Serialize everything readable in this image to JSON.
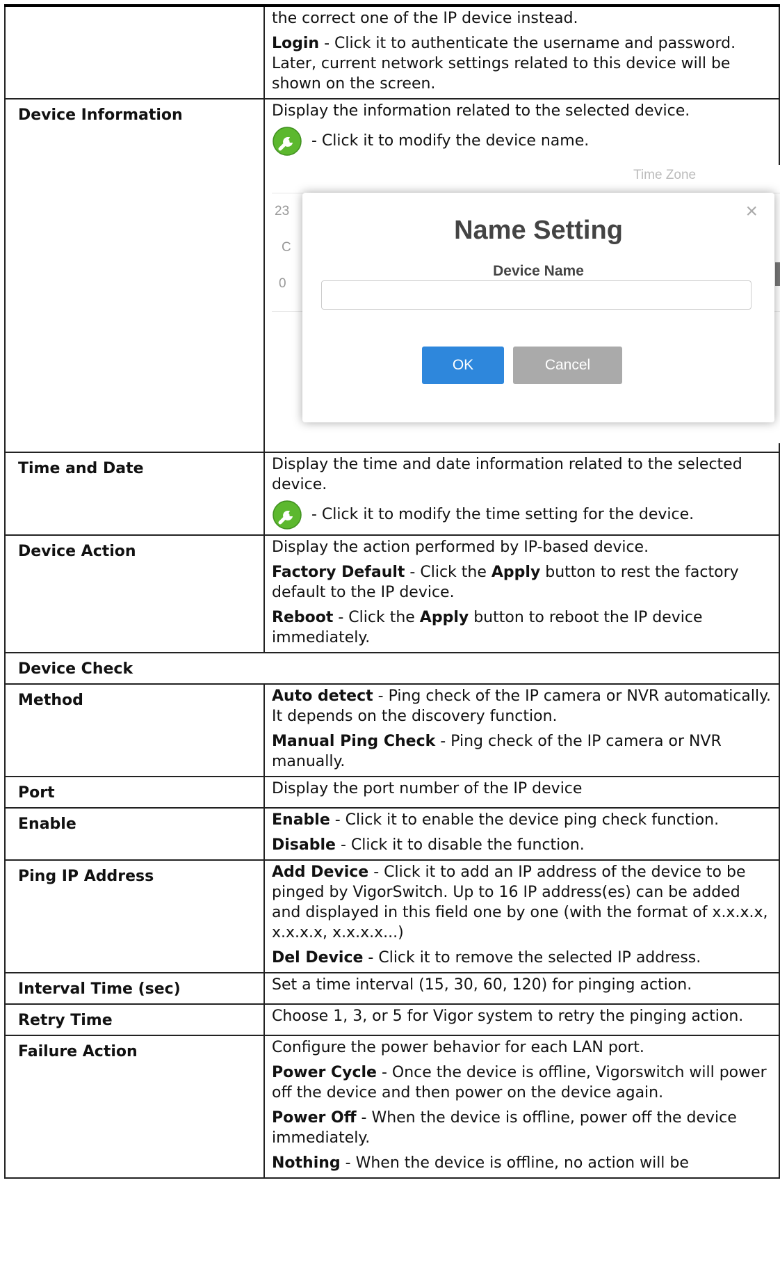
{
  "rows": {
    "login": {
      "cont_text": "the correct one of the IP device instead.",
      "login_term": "Login",
      "login_text": " - Click it to authenticate the username and password. Later, current network settings related to this device will be shown on the screen."
    },
    "device_info": {
      "label": "Device Information",
      "line1": "Display the information related to the selected device.",
      "icon_text": " - Click it to modify the device name.",
      "dialog": {
        "bg_header": "Time Zone",
        "bg_fragments": [
          "23",
          "C",
          "0"
        ],
        "title": "Name Setting",
        "field_label": "Device Name",
        "field_value": "",
        "ok_label": "OK",
        "cancel_label": "Cancel",
        "close_glyph": "×"
      }
    },
    "time_date": {
      "label": "Time and Date",
      "line1": "Display the time and date information related to the selected device.",
      "icon_text": " - Click it to modify the time setting for the device."
    },
    "device_action": {
      "label": "Device Action",
      "line1": "Display the action performed by IP-based device.",
      "fd_term": "Factory Default",
      "fd_pre": " - Click the ",
      "apply": "Apply",
      "fd_post": " button to rest the factory default to the IP device.",
      "rb_term": "Reboot",
      "rb_pre": " - Click the ",
      "rb_post": " button to reboot the IP device immediately."
    },
    "device_check": {
      "label": "Device Check"
    },
    "method": {
      "label": "Method",
      "auto_term": "Auto detect",
      "auto_text": " - Ping check of the IP camera or NVR automatically. It depends on the discovery function.",
      "manual_term": "Manual Ping Check",
      "manual_text": " - Ping check of the IP camera or NVR manually."
    },
    "port": {
      "label": "Port",
      "line1": "Display the port number of the IP device"
    },
    "enable": {
      "label": "Enable",
      "en_term": "Enable",
      "en_text": " - Click it to enable the device ping check function.",
      "dis_term": "Disable",
      "dis_text": " - Click it to disable the function."
    },
    "ping_ip": {
      "label": "Ping IP Address",
      "add_term": "Add Device",
      "add_text": " - Click it to add an IP address of the device to be pinged by VigorSwitch. Up to 16 IP address(es) can be   added and displayed in this field one by one (with the format of x.x.x.x, x.x.x.x, x.x.x.x...)",
      "del_term": "Del Device",
      "del_text": " - Click it to remove the selected IP address."
    },
    "interval": {
      "label": "Interval Time (sec)",
      "line1": "Set a time interval (15, 30, 60, 120) for pinging action."
    },
    "retry": {
      "label": "Retry Time",
      "line1": "Choose 1, 3, or 5 for Vigor system to retry the pinging action."
    },
    "failure": {
      "label": "Failure Action",
      "line1": "Configure the power behavior for each LAN port.",
      "pc_term": "Power Cycle",
      "pc_text": " - Once the device is offline, Vigorswitch will power off the device and then power on the device again.",
      "po_term": "Power Off",
      "po_text": " - When the device is offline, power off the device immediately.",
      "no_term": "Nothing",
      "no_text": " - When the device is offline, no action will be"
    }
  },
  "icons": {
    "edit": "wrench-icon",
    "edit_color": "#5cb82e"
  }
}
